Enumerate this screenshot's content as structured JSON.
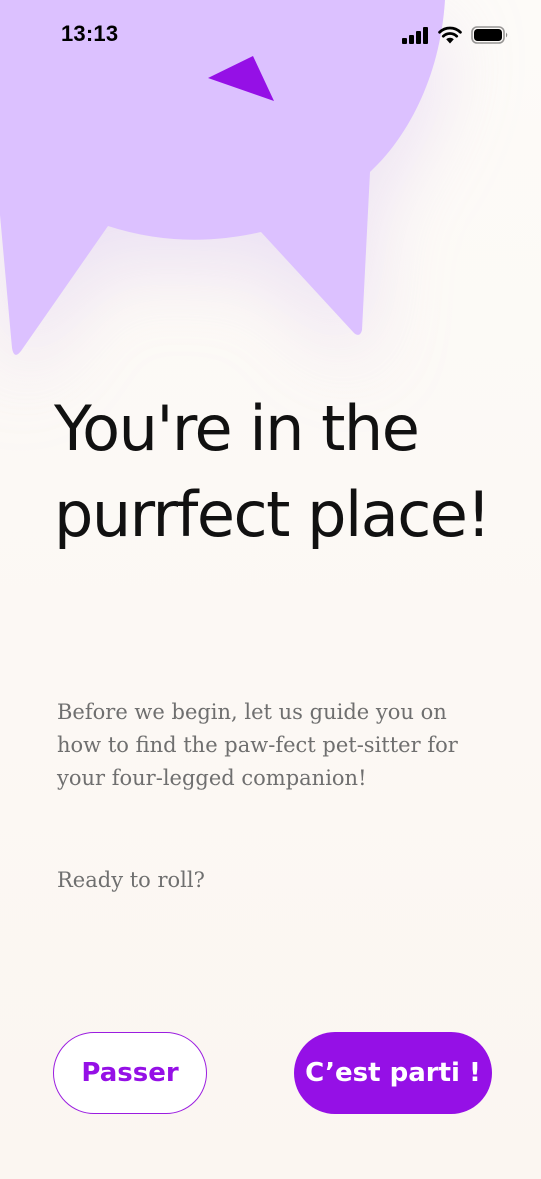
{
  "status_bar": {
    "time": "13:13",
    "icons": [
      "cellular-signal-icon",
      "wifi-icon",
      "battery-icon"
    ]
  },
  "hero": {
    "illustration": "cat-head-shape",
    "colors": {
      "shape": "#dcc1ff",
      "accent": "#9510e6"
    }
  },
  "headline": "You're in the purrfect place!",
  "intro_text": "Before we begin, let us guide you on how to find the paw-fect pet-sitter for your four-legged companion!",
  "prompt_text": "Ready to roll?",
  "actions": {
    "skip_label": "Passer",
    "start_label": "C’est parti !"
  },
  "theme": {
    "background": "#fcf8f4",
    "primary": "#9510e6",
    "text": "#111111",
    "muted_text": "#6f6f6f"
  }
}
